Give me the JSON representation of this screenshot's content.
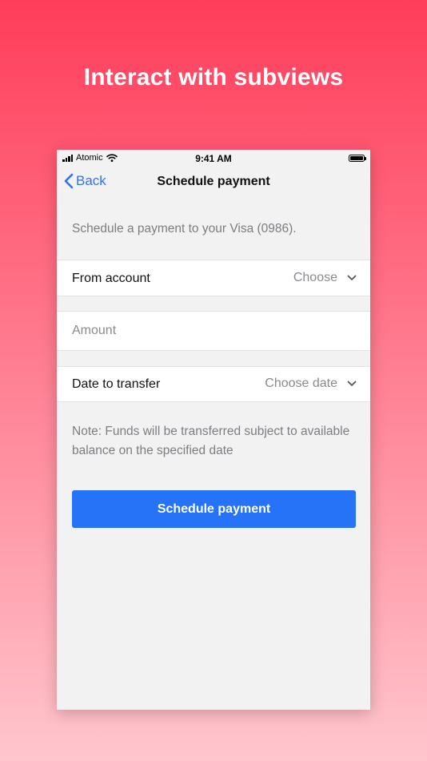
{
  "headline": "Interact with subviews",
  "status_bar": {
    "carrier": "Atomic",
    "time": "9:41 AM"
  },
  "nav": {
    "back_label": "Back",
    "title": "Schedule payment"
  },
  "intro_text": "Schedule a payment to your Visa (0986).",
  "from_account": {
    "label": "From account",
    "value": "Choose"
  },
  "amount": {
    "placeholder": "Amount",
    "value": ""
  },
  "date_to_transfer": {
    "label": "Date to transfer",
    "value": "Choose date"
  },
  "note": "Note: Funds will be transferred subject to available balance on the specified date",
  "submit_label": "Schedule payment",
  "colors": {
    "accent": "#2673f7",
    "background_top": "#ff3d5a",
    "background_bottom": "#ffc6cd"
  }
}
